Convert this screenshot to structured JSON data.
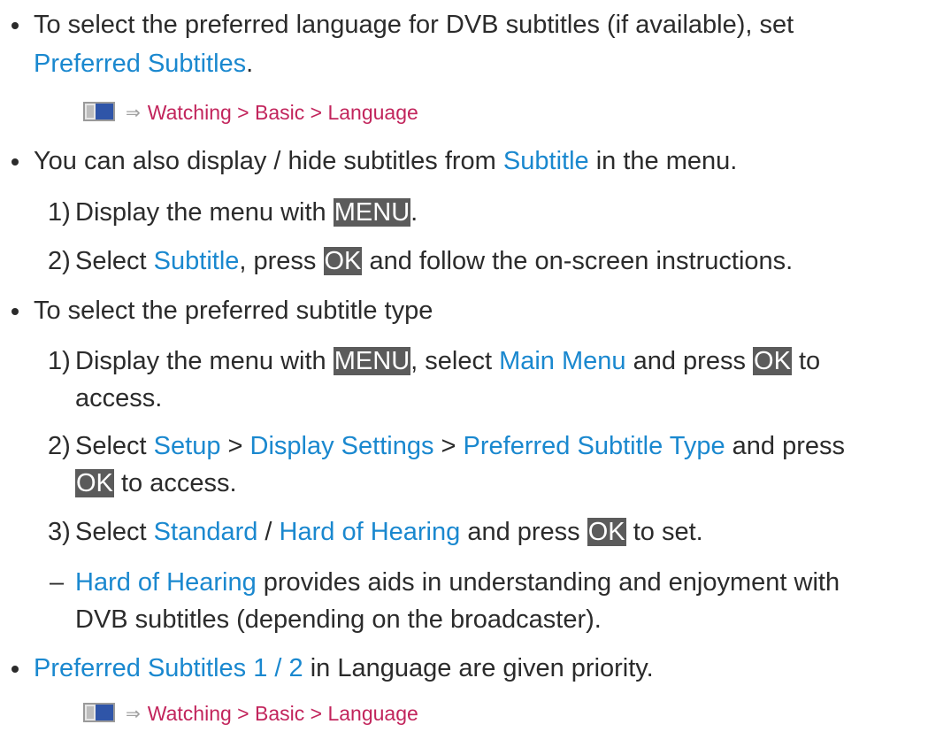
{
  "items": {
    "b1": {
      "line1": "To select the preferred language for DVB subtitles (if available), set",
      "link": "Preferred Subtitles",
      "end": "."
    },
    "path1": {
      "text": "Watching > Basic > Language"
    },
    "b2": {
      "pre": "You can also display / hide subtitles from ",
      "link": "Subtitle",
      "post": " in the menu."
    },
    "b2s1": {
      "num": "1)",
      "pre": "Display the menu with ",
      "key": "MENU",
      "post": "."
    },
    "b2s2": {
      "num": "2)",
      "pre": "Select ",
      "link": "Subtitle",
      "mid": ", press ",
      "key": "OK",
      "post": " and follow the on-screen instructions."
    },
    "b3": {
      "text": "To select the preferred subtitle type"
    },
    "b3s1": {
      "num": "1)",
      "pre": "Display the menu with ",
      "key": "MENU",
      "mid": ", select ",
      "link": "Main Menu",
      "mid2": " and press ",
      "key2": "OK",
      "post": " to",
      "line2": "access."
    },
    "b3s2": {
      "num": "2)",
      "pre": "Select ",
      "link1": "Setup",
      "sep1": " > ",
      "link2": "Display Settings",
      "sep2": " > ",
      "link3": "Preferred Subtitle Type",
      "post": " and press",
      "key": "OK",
      "line2post": " to access."
    },
    "b3s3": {
      "num": "3)",
      "pre": "Select ",
      "link1": "Standard",
      "sep": " / ",
      "link2": "Hard of Hearing",
      "mid": " and press ",
      "key": "OK",
      "post": " to set."
    },
    "note": {
      "dash": "–",
      "link": "Hard of Hearing",
      "post": " provides aids in understanding and enjoyment with",
      "line2": "DVB subtitles (depending on the broadcaster)."
    },
    "b4": {
      "link": "Preferred Subtitles 1 / 2",
      "post": " in Language are given priority."
    },
    "path2": {
      "text": "Watching > Basic > Language"
    }
  },
  "icons": {
    "tv": "tv-menu-icon",
    "arrow": "right-arrow-icon"
  },
  "colors": {
    "text": "#2b2b2b",
    "link": "#1a88cf",
    "path": "#c2255c",
    "key_bg": "#5b5b5b",
    "key_fg": "#ffffff"
  }
}
